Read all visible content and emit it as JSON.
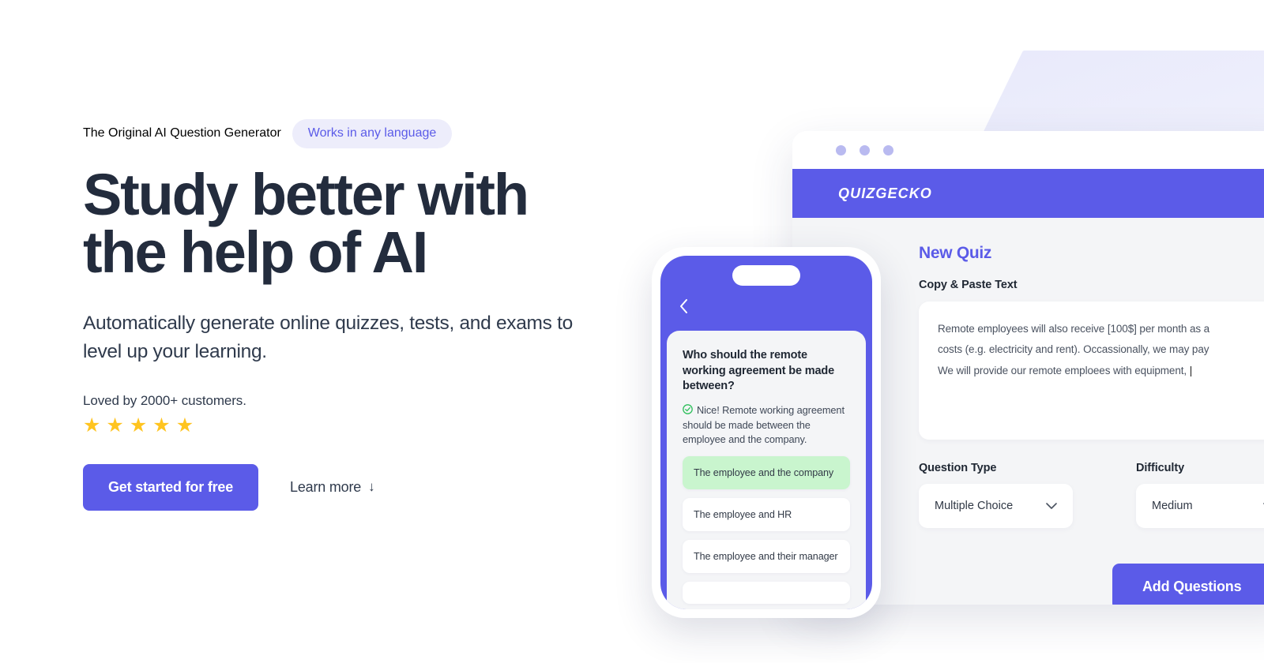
{
  "hero": {
    "eyebrow": "The Original AI Question Generator",
    "language_badge": "Works in any language",
    "headline_line1": "Study better with",
    "headline_line2": "the help of AI",
    "subhead": "Automatically generate online quizzes, tests, and exams to level up your learning.",
    "loved_by": "Loved by 2000+ customers.",
    "star_glyph": "★",
    "star_count": 5,
    "primary_cta": "Get started for free",
    "secondary_cta": "Learn more",
    "secondary_cta_arrow": "↓"
  },
  "browser": {
    "brand": "QUIZGECKO",
    "dots": 3,
    "panel": {
      "title": "New Quiz",
      "paste_label": "Copy & Paste Text",
      "pasted_text_lines": [
        "Remote employees will also receive [100$] per month as a",
        "costs (e.g. electricity and rent). Occassionally, we may pay",
        "We will provide our remote emploees with equipment,"
      ],
      "caret": "|",
      "question_type_label": "Question Type",
      "question_type_value": "Multiple Choice",
      "difficulty_label": "Difficulty",
      "difficulty_value": "Medium",
      "add_button": "Add Questions"
    }
  },
  "phone": {
    "back_icon": "chevron-left-icon",
    "question": "Who should the remote working agreement be made between?",
    "feedback": "Nice! Remote working agreement should be made between the employee and the company.",
    "options": [
      {
        "label": "The employee and the company",
        "correct": true
      },
      {
        "label": "The employee and HR",
        "correct": false
      },
      {
        "label": "The employee and their manager",
        "correct": false
      },
      {
        "label": "",
        "correct": false
      }
    ]
  },
  "colors": {
    "accent": "#5B5BE8",
    "accent_light": "#EDEDFB",
    "headline": "#232C3D",
    "star": "#FFC420",
    "correct_bg": "#C9F5CE",
    "panel_bg": "#F4F5F7"
  }
}
